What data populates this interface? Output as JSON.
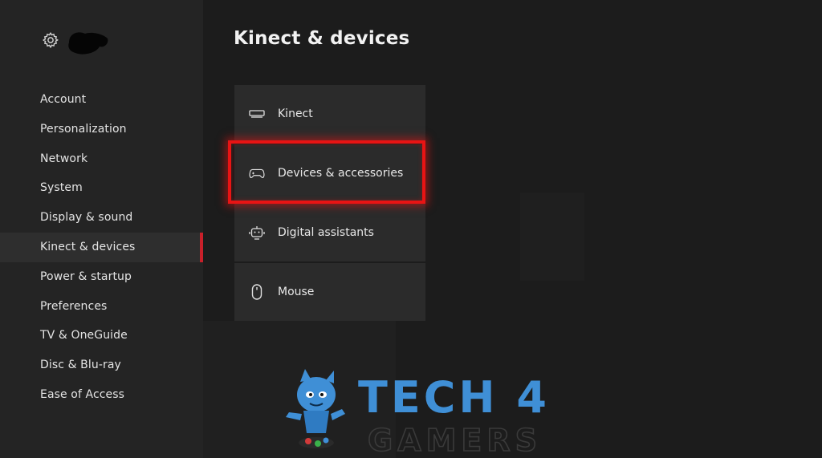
{
  "sidebar": {
    "items": [
      {
        "label": "Account"
      },
      {
        "label": "Personalization"
      },
      {
        "label": "Network"
      },
      {
        "label": "System"
      },
      {
        "label": "Display & sound"
      },
      {
        "label": "Kinect & devices"
      },
      {
        "label": "Power & startup"
      },
      {
        "label": "Preferences"
      },
      {
        "label": "TV & OneGuide"
      },
      {
        "label": "Disc & Blu-ray"
      },
      {
        "label": "Ease of Access"
      }
    ],
    "selected_index": 5,
    "header_icon": "gear-icon"
  },
  "main": {
    "title": "Kinect & devices",
    "tiles": [
      {
        "label": "Kinect",
        "icon": "kinect-sensor-icon"
      },
      {
        "label": "Devices & accessories",
        "icon": "controller-icon"
      },
      {
        "label": "Digital assistants",
        "icon": "assistant-icon"
      },
      {
        "label": "Mouse",
        "icon": "mouse-icon"
      }
    ],
    "focused_index": 1
  },
  "watermark": {
    "line1": "TECH 4",
    "line2": "GAMERS"
  },
  "colors": {
    "accent": "#c8202a",
    "highlight": "#e81414",
    "watermark_blue": "#3f8fd6"
  }
}
